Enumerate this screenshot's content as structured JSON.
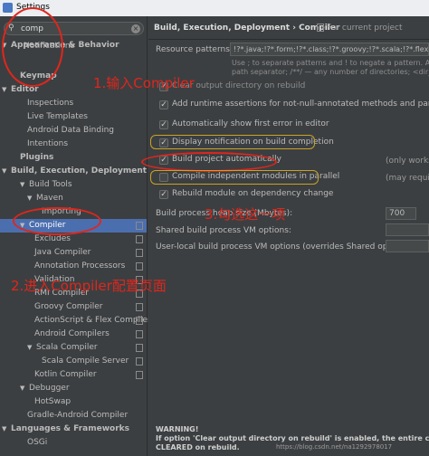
{
  "window": {
    "title": "Settings"
  },
  "search": {
    "value": "comp"
  },
  "tree": [
    {
      "label": "Appearance & Behavior",
      "arrow": "▼",
      "bold": true
    },
    {
      "label": "Notifications"
    },
    {
      "label": "Keymap",
      "bold": true
    },
    {
      "label": "Editor",
      "arrow": "▼",
      "bold": true
    },
    {
      "label": "Inspections"
    },
    {
      "label": "Live Templates"
    },
    {
      "label": "Android Data Binding"
    },
    {
      "label": "Intentions"
    },
    {
      "label": "Plugins",
      "bold": true
    },
    {
      "label": "Build, Execution, Deployment",
      "arrow": "▼",
      "bold": true
    },
    {
      "label": "Build Tools",
      "arrow": "▼"
    },
    {
      "label": "Maven",
      "arrow": "▼"
    },
    {
      "label": "Importing"
    },
    {
      "label": "Compiler",
      "arrow": "▼",
      "selected": true
    },
    {
      "label": "Excludes"
    },
    {
      "label": "Java Compiler"
    },
    {
      "label": "Annotation Processors"
    },
    {
      "label": "Validation"
    },
    {
      "label": "RMI Compiler"
    },
    {
      "label": "Groovy Compiler"
    },
    {
      "label": "ActionScript & Flex Compiler"
    },
    {
      "label": "Android Compilers"
    },
    {
      "label": "Scala Compiler",
      "arrow": "▼"
    },
    {
      "label": "Scala Compile Server"
    },
    {
      "label": "Kotlin Compiler"
    },
    {
      "label": "Debugger",
      "arrow": "▼"
    },
    {
      "label": "HotSwap"
    },
    {
      "label": "Gradle-Android Compiler"
    },
    {
      "label": "Languages & Frameworks",
      "arrow": "▼",
      "bold": true
    },
    {
      "label": "OSGi"
    }
  ],
  "main": {
    "breadcrumb": "Build, Execution, Deployment › Compiler",
    "breadcrumb_scope": "For current project",
    "resource_label": "Resource patterns:",
    "resource_value": "!?*.java;!?*.form;!?*.class;!?*.groovy;!?*.scala;!?*.flex;",
    "hint1": "Use ; to separate patterns and ! to negate a pattern. Accepted",
    "hint2": "path separator; /**/ — any number of directories; <dir_name",
    "options": [
      {
        "label": "Clear output directory on rebuild",
        "checked": true
      },
      {
        "label": "Add runtime assertions for not-null-annotated methods and parameters",
        "checked": true
      },
      {
        "label": "Automatically show first error in editor",
        "checked": true
      },
      {
        "label": "Display notification on build completion",
        "checked": true
      },
      {
        "label": "Build project automatically",
        "checked": true
      },
      {
        "label": "Compile independent modules in parallel",
        "checked": false
      },
      {
        "label": "Rebuild module on dependency change",
        "checked": true
      }
    ],
    "only_works": "(only works",
    "may_require": "(may require",
    "heap_label": "Build process heap size (Mbytes):",
    "heap_value": "700",
    "shared_vm_label": "Shared build process VM options:",
    "user_vm_label": "User-local build process VM options (overrides Shared options):",
    "warning_title": "WARNING!",
    "warning_line1": "If option 'Clear output directory on rebuild' is enabled, the entire contents",
    "warning_line2": "CLEARED on rebuild."
  },
  "annotations": {
    "step1": "1.输入Compiler",
    "step2": "2.进入Compiler配置页面",
    "step3": "3.勾选这一项"
  },
  "watermark": "https://blog.csdn.net/na1292978017",
  "colors": {
    "annotation": "#e0261c",
    "selection": "#4b6eaf",
    "highlight": "#c9a227",
    "background": "#3c3f41"
  }
}
